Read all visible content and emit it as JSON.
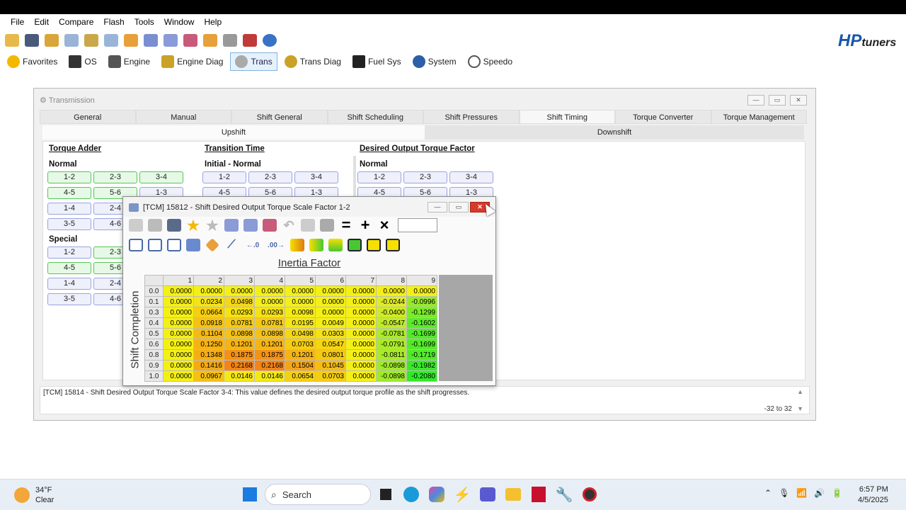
{
  "menu": [
    "File",
    "Edit",
    "Compare",
    "Flash",
    "Tools",
    "Window",
    "Help"
  ],
  "logo": {
    "main": "HP",
    "sub": "tuners"
  },
  "nav": [
    {
      "label": "Favorites",
      "color": "#f5b800"
    },
    {
      "label": "OS",
      "color": "#333333"
    },
    {
      "label": "Engine",
      "color": "#555555"
    },
    {
      "label": "Engine Diag",
      "color": "#c9a227"
    },
    {
      "label": "Trans",
      "color": "#888888"
    },
    {
      "label": "Trans Diag",
      "color": "#c9a227"
    },
    {
      "label": "Fuel Sys",
      "color": "#222222"
    },
    {
      "label": "System",
      "color": "#2d5fa8"
    },
    {
      "label": "Speedo",
      "color": "#555555"
    }
  ],
  "window": {
    "title": "Transmission",
    "tabs": [
      "General",
      "Manual",
      "Shift General",
      "Shift Scheduling",
      "Shift Pressures",
      "Shift Timing",
      "Torque Converter",
      "Torque Management"
    ],
    "active_tab": "Shift Timing",
    "subtabs": [
      "Upshift",
      "Downshift"
    ],
    "sections": {
      "torque_adder": {
        "title": "Torque Adder",
        "normal": "Normal",
        "special": "Special"
      },
      "transition": {
        "title": "Transition Time",
        "sub": "Initial - Normal"
      },
      "desired": {
        "title": "Desired Output Torque Factor",
        "sub": "Normal"
      }
    },
    "buttons": {
      "b12": "1-2",
      "b23": "2-3",
      "b34": "3-4",
      "b45": "4-5",
      "b56": "5-6",
      "b13": "1-3",
      "b14": "1-4",
      "b24": "2-4",
      "b35": "3-5",
      "b46": "4-6"
    },
    "status_msg": "[TCM] 15814 - Shift Desired Output Torque Scale Factor 3-4: This value defines the desired output torque profile as the shift progresses.",
    "range": "-32 to 32"
  },
  "popup": {
    "title": "[TCM] 15812 - Shift Desired Output Torque Scale Factor 1-2",
    "table_title": "Inertia Factor",
    "y_label": "Shift Completion",
    "columns": [
      "1",
      "2",
      "3",
      "4",
      "5",
      "6",
      "7",
      "8",
      "9"
    ],
    "rows": [
      {
        "h": "0.0",
        "v": [
          "0.0000",
          "0.0000",
          "0.0000",
          "0.0000",
          "0.0000",
          "0.0000",
          "0.0000",
          "0.0000",
          "0.0000"
        ]
      },
      {
        "h": "0.1",
        "v": [
          "0.0000",
          "0.0234",
          "0.0498",
          "0.0000",
          "0.0000",
          "0.0000",
          "0.0000",
          "-0.0244",
          "-0.0996"
        ]
      },
      {
        "h": "0.3",
        "v": [
          "0.0000",
          "0.0664",
          "0.0293",
          "0.0293",
          "0.0098",
          "0.0000",
          "0.0000",
          "-0.0400",
          "-0.1299"
        ]
      },
      {
        "h": "0.4",
        "v": [
          "0.0000",
          "0.0918",
          "0.0781",
          "0.0781",
          "0.0195",
          "0.0049",
          "0.0000",
          "-0.0547",
          "-0.1602"
        ]
      },
      {
        "h": "0.5",
        "v": [
          "0.0000",
          "0.1104",
          "0.0898",
          "0.0898",
          "0.0498",
          "0.0303",
          "0.0000",
          "-0.0781",
          "-0.1699"
        ]
      },
      {
        "h": "0.6",
        "v": [
          "0.0000",
          "0.1250",
          "0.1201",
          "0.1201",
          "0.0703",
          "0.0547",
          "0.0000",
          "-0.0791",
          "-0.1699"
        ]
      },
      {
        "h": "0.8",
        "v": [
          "0.0000",
          "0.1348",
          "0.1875",
          "0.1875",
          "0.1201",
          "0.0801",
          "0.0000",
          "-0.0811",
          "-0.1719"
        ]
      },
      {
        "h": "0.9",
        "v": [
          "0.0000",
          "0.1416",
          "0.2168",
          "0.2168",
          "0.1504",
          "0.1045",
          "0.0000",
          "-0.0898",
          "-0.1982"
        ]
      },
      {
        "h": "1.0",
        "v": [
          "0.0000",
          "0.0967",
          "0.0146",
          "0.0146",
          "0.0654",
          "0.0703",
          "0.0000",
          "-0.0898",
          "-0.2080"
        ]
      }
    ]
  },
  "taskbar": {
    "temp": "34°F",
    "weather": "Clear",
    "search": "Search",
    "time": "6:57 PM",
    "date": "4/5/2025"
  }
}
